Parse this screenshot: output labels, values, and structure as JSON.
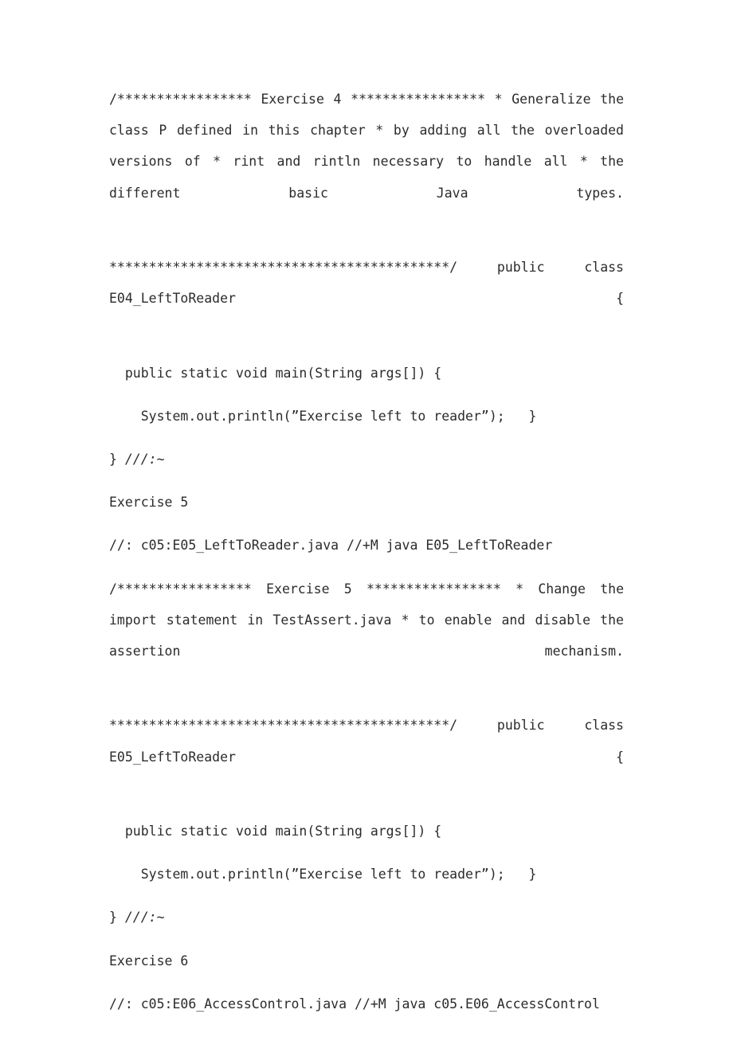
{
  "document": {
    "page_background": "#ffffff",
    "text_color": "#2b2b2b",
    "blocks": [
      {
        "id": "ex4_comment",
        "kind": "justified-paragraph",
        "text": "/***************** Exercise 4 *****************  * Generalize the class P defined in this chapter  * by adding all the overloaded versions of  * rint and rintln necessary to handle all  * the different basic Java types."
      },
      {
        "id": "ex4_comment_close",
        "kind": "justified-paragraph",
        "text": " *******************************************/  public class E04_LeftToReader {"
      },
      {
        "id": "ex4_main_sig",
        "kind": "code-line",
        "text": "  public static void main(String args[]) {"
      },
      {
        "id": "ex4_println",
        "kind": "code-line",
        "text": "    System.out.println(”Exercise left to reader”);   }"
      },
      {
        "id": "ex4_close",
        "kind": "code-line-italic-tail",
        "text_plain": "} ",
        "text_italic": "///:~"
      },
      {
        "id": "ex5_heading",
        "kind": "code-line",
        "text": "Exercise 5"
      },
      {
        "id": "ex5_filepath",
        "kind": "code-line",
        "text": "//: c05:E05_LeftToReader.java //+M java E05_LeftToReader"
      },
      {
        "id": "ex5_comment",
        "kind": "justified-paragraph",
        "text": "/***************** Exercise 5 *****************  * Change the import statement in TestAssert.java  * to enable and disable the assertion mechanism."
      },
      {
        "id": "ex5_comment_close",
        "kind": "justified-paragraph",
        "text": " *******************************************/  public class E05_LeftToReader {"
      },
      {
        "id": "ex5_main_sig",
        "kind": "code-line",
        "text": "  public static void main(String args[]) {"
      },
      {
        "id": "ex5_println",
        "kind": "code-line",
        "text": "    System.out.println(”Exercise left to reader”);   }"
      },
      {
        "id": "ex5_close",
        "kind": "code-line-italic-tail",
        "text_plain": "} ",
        "text_italic": "///:~"
      },
      {
        "id": "ex6_heading",
        "kind": "code-line",
        "text": "Exercise 6"
      },
      {
        "id": "ex6_filepath",
        "kind": "code-line",
        "text": "//: c05:E06_AccessControl.java //+M java c05.E06_AccessControl"
      }
    ]
  }
}
